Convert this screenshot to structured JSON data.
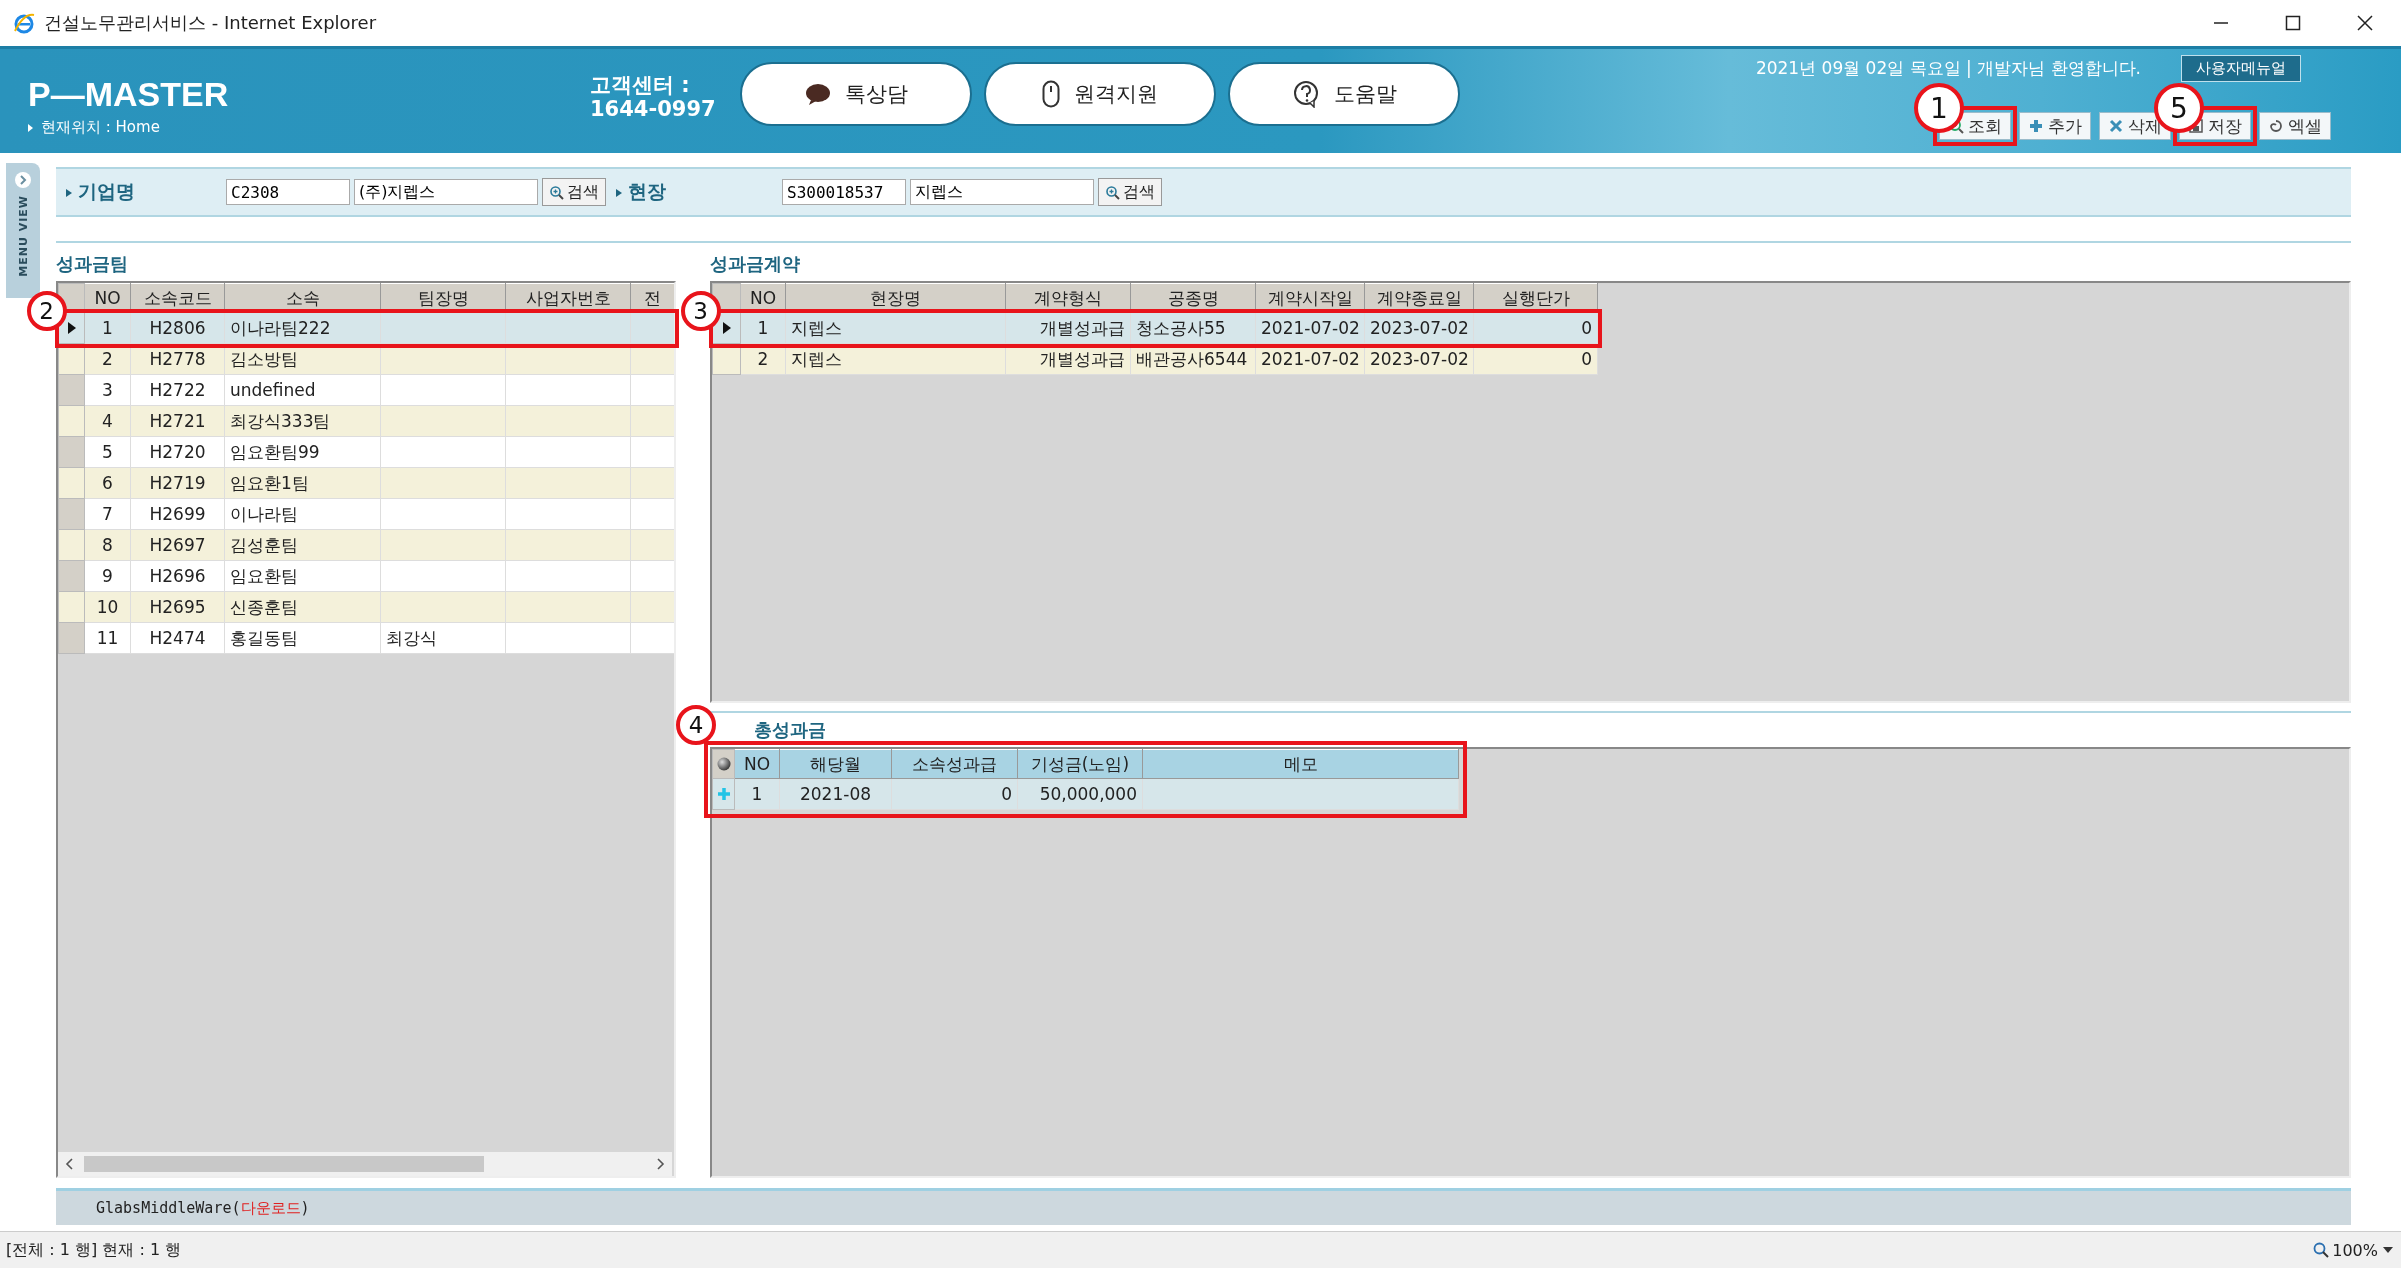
{
  "window": {
    "title": "건설노무관리서비스 - Internet Explorer"
  },
  "header": {
    "logo": "P—MASTER",
    "breadcrumb": "현재위치 : Home",
    "support_label": "고객센터 :",
    "support_phone": "1644-0997",
    "greeting": "2021년 09월 02일 목요일 | 개발자님 환영합니다.",
    "manual_button": "사용자메뉴얼"
  },
  "header_buttons": [
    {
      "kind": "chat",
      "label": "톡상담"
    },
    {
      "kind": "remote",
      "label": "원격지원"
    },
    {
      "kind": "help",
      "label": "도움말"
    }
  ],
  "toolbar": [
    {
      "kind": "search",
      "label": "조회",
      "callout": "1"
    },
    {
      "kind": "add",
      "label": "추가"
    },
    {
      "kind": "delete",
      "label": "삭제"
    },
    {
      "kind": "save",
      "label": "저장",
      "callout": "5"
    },
    {
      "kind": "excel",
      "label": "엑셀"
    }
  ],
  "side_tab": "MENU VIEW",
  "filters": [
    {
      "label": "기업명",
      "code": "C2308",
      "name": "(주)지렙스",
      "button": "검색"
    },
    {
      "label": "현장",
      "code": "S300018537",
      "name": "지렙스",
      "button": "검색"
    }
  ],
  "teams": {
    "title": "성과금팀",
    "columns": [
      "NO",
      "소속코드",
      "소속",
      "팀장명",
      "사업자번호",
      "전"
    ],
    "rows": [
      {
        "cells": [
          "1",
          "H2806",
          "이나라팀222",
          "",
          ""
        ],
        "selected": true,
        "callout": "2"
      },
      {
        "cells": [
          "2",
          "H2778",
          "김소방팀",
          "",
          ""
        ],
        "selected": false
      },
      {
        "cells": [
          "3",
          "H2722",
          "undefined",
          "",
          ""
        ],
        "selected": false
      },
      {
        "cells": [
          "4",
          "H2721",
          "최강식333팀",
          "",
          ""
        ],
        "selected": false
      },
      {
        "cells": [
          "5",
          "H2720",
          "임요환팀99",
          "",
          ""
        ],
        "selected": false
      },
      {
        "cells": [
          "6",
          "H2719",
          "임요환1팀",
          "",
          ""
        ],
        "selected": false
      },
      {
        "cells": [
          "7",
          "H2699",
          "이나라팀",
          "",
          ""
        ],
        "selected": false
      },
      {
        "cells": [
          "8",
          "H2697",
          "김성훈팀",
          "",
          ""
        ],
        "selected": false
      },
      {
        "cells": [
          "9",
          "H2696",
          "임요환팀",
          "",
          ""
        ],
        "selected": false
      },
      {
        "cells": [
          "10",
          "H2695",
          "신종훈팀",
          "",
          ""
        ],
        "selected": false
      },
      {
        "cells": [
          "11",
          "H2474",
          "홍길동팀",
          "최강식",
          ""
        ],
        "selected": false
      }
    ]
  },
  "contracts": {
    "title": "성과금계약",
    "columns": [
      "NO",
      "현장명",
      "계약형식",
      "공종명",
      "계약시작일",
      "계약종료일",
      "실행단가"
    ],
    "rows": [
      {
        "cells": [
          "1",
          "지렙스",
          "개별성과급",
          "청소공사55",
          "2021-07-02",
          "2023-07-02",
          "0"
        ],
        "selected": true,
        "callout": "3"
      },
      {
        "cells": [
          "2",
          "지렙스",
          "개별성과급",
          "배관공사6544",
          "2021-07-02",
          "2023-07-02",
          "0"
        ],
        "selected": false
      }
    ]
  },
  "bonus": {
    "title": "총성과금",
    "callout": "4",
    "columns": [
      "NO",
      "해당월",
      "소속성과급",
      "기성금(노임)",
      "메모"
    ],
    "rows": [
      {
        "cells": [
          "1",
          "2021-08",
          "0",
          "50,000,000",
          ""
        ],
        "added": true
      }
    ]
  },
  "footer": {
    "text": "GlabsMiddleWare(",
    "link": "다운로드",
    "text_end": ")"
  },
  "status_bar": {
    "text": "[전체 : 1 행] 현재 : 1 행",
    "zoom": "100%"
  }
}
